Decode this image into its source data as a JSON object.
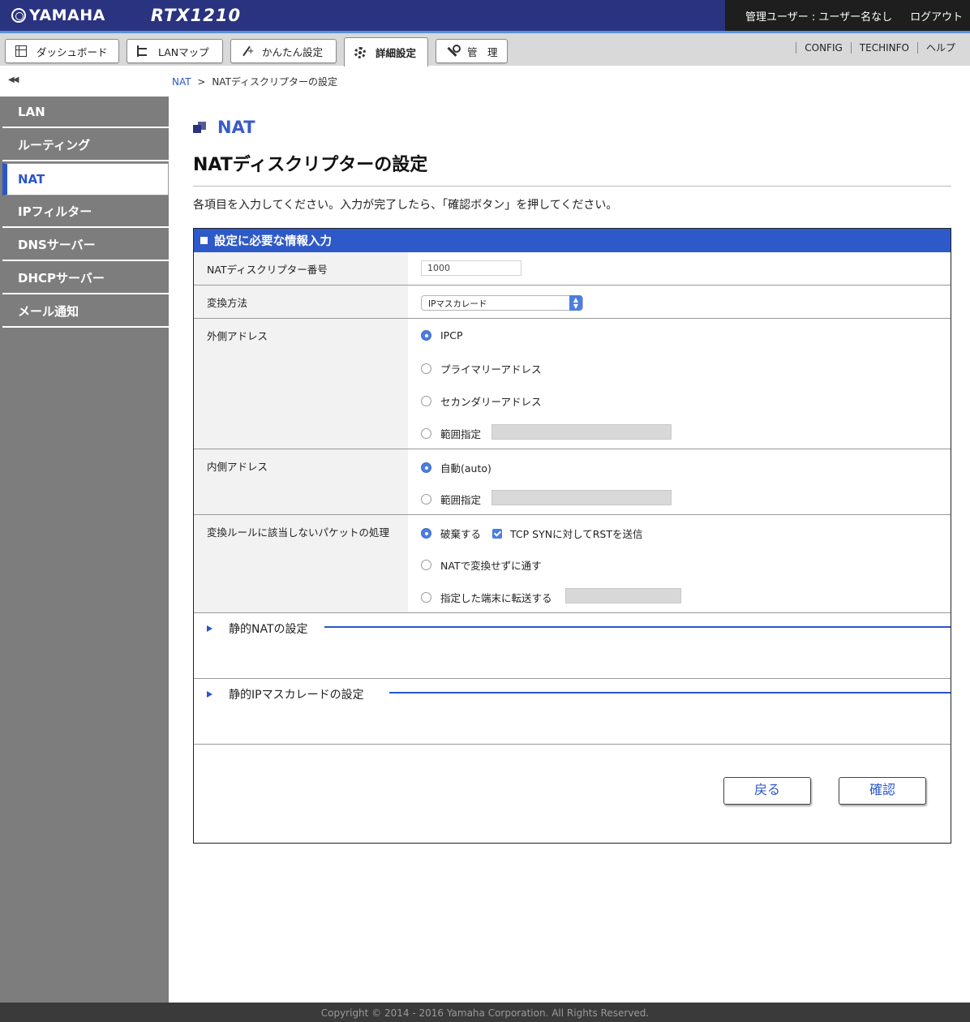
{
  "header": {
    "brand": "YAMAHA",
    "model": "RTX1210",
    "user": "管理ユーザー : ユーザー名なし",
    "logout": "ログアウト"
  },
  "tabs": [
    {
      "label": "ダッシュボード",
      "icon": "dashboard-icon"
    },
    {
      "label": "LANマップ",
      "icon": "lan-map-icon"
    },
    {
      "label": "かんたん設定",
      "icon": "wand-icon"
    },
    {
      "label": "詳細設定",
      "icon": "gear-icon",
      "active": true
    },
    {
      "label": "管　理",
      "icon": "wrench-icon"
    }
  ],
  "top_links": [
    "CONFIG",
    "TECHINFO",
    "ヘルプ"
  ],
  "sidebar": {
    "collapse": "◀◀",
    "items": [
      {
        "label": "LAN"
      },
      {
        "label": "ルーティング"
      },
      {
        "label": "NAT",
        "active": true
      },
      {
        "label": "IPフィルター"
      },
      {
        "label": "DNSサーバー"
      },
      {
        "label": "DHCPサーバー"
      },
      {
        "label": "メール通知"
      }
    ]
  },
  "breadcrumb": {
    "parent": "NAT",
    "separator": ">",
    "current": "NATディスクリプターの設定"
  },
  "section_title": "NAT",
  "page_title": "NATディスクリプターの設定",
  "intro": "各項目を入力してください。入力が完了したら、「確認ボタン」を押してください。",
  "form": {
    "header": "設定に必要な情報入力",
    "descriptor_number": {
      "label": "NATディスクリプター番号",
      "value": "1000"
    },
    "conversion": {
      "label": "変換方法",
      "selected": "IPマスカレード"
    },
    "outer_address": {
      "label": "外側アドレス",
      "options": [
        "IPCP",
        "プライマリーアドレス",
        "セカンダリーアドレス",
        "範囲指定"
      ],
      "selected": "IPCP"
    },
    "inner_address": {
      "label": "内側アドレス",
      "options": [
        "自動(auto)",
        "範囲指定"
      ],
      "selected": "自動(auto)"
    },
    "unmatched": {
      "label": "変換ルールに該当しないパケットの処理",
      "options": [
        "破棄する",
        "NATで変換せずに通す",
        "指定した端末に転送する"
      ],
      "selected": "破棄する",
      "checkbox_label": "TCP SYNに対してRSTを送信",
      "checkbox_checked": true
    },
    "static_nat": "静的NATの設定",
    "static_masq": "静的IPマスカレードの設定"
  },
  "buttons": {
    "back": "戻る",
    "confirm": "確認"
  },
  "footer": "Copyright © 2014 - 2016 Yamaha Corporation. All Rights Reserved.",
  "colors": {
    "header_bg": "#2a3380",
    "accent": "#2e59c8",
    "sidebar_bg": "#7d7d7d"
  }
}
